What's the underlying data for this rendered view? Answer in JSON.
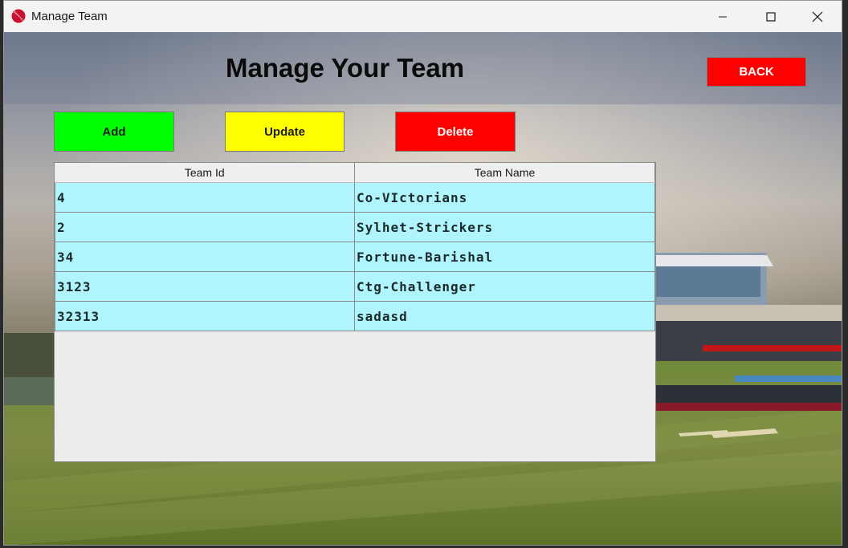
{
  "window": {
    "title": "Manage Team",
    "app_icon": "cricket-ball-icon"
  },
  "heading": "Manage Your Team",
  "buttons": {
    "back": "BACK",
    "add": "Add",
    "update": "Update",
    "delete": "Delete"
  },
  "colors": {
    "add": "#00ff00",
    "update": "#ffff00",
    "delete": "#ff0000",
    "back": "#ff0000",
    "row": "#b0f4fe"
  },
  "table": {
    "columns": [
      "Team Id",
      "Team Name"
    ],
    "rows": [
      [
        "4",
        "Co-VIctorians"
      ],
      [
        "2",
        "Sylhet-Strickers"
      ],
      [
        "34",
        "Fortune-Barishal"
      ],
      [
        "3123",
        "Ctg-Challenger"
      ],
      [
        "32313",
        "sadasd"
      ]
    ]
  }
}
